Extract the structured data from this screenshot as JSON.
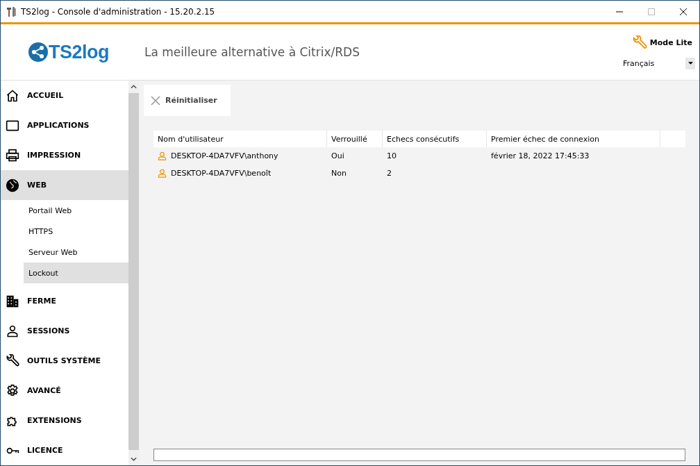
{
  "window": {
    "title": "TS2log - Console d'administration - 15.20.2.15"
  },
  "header": {
    "logo": "TS2log",
    "tagline": "La meilleure alternative à Citrix/RDS",
    "mode_button": "Mode Lite",
    "language": "Français"
  },
  "sidebar": {
    "items": [
      {
        "label": "ACCUEIL",
        "selected": false
      },
      {
        "label": "APPLICATIONS",
        "selected": false
      },
      {
        "label": "IMPRESSION",
        "selected": false
      },
      {
        "label": "WEB",
        "selected": true,
        "children": [
          {
            "label": "Portail Web",
            "selected": false
          },
          {
            "label": "HTTPS",
            "selected": false
          },
          {
            "label": "Serveur Web",
            "selected": false
          },
          {
            "label": "Lockout",
            "selected": true
          }
        ]
      },
      {
        "label": "FERME",
        "selected": false
      },
      {
        "label": "SESSIONS",
        "selected": false
      },
      {
        "label": "OUTILS SYSTÈME",
        "selected": false
      },
      {
        "label": "AVANCÉ",
        "selected": false
      },
      {
        "label": "EXTENSIONS",
        "selected": false
      },
      {
        "label": "LICENCE",
        "selected": false
      }
    ]
  },
  "toolbar": {
    "reset_button": "Réinitialiser"
  },
  "table": {
    "columns": [
      "Nom d'utilisateur",
      "Verrouillé",
      "Echecs consécutifs",
      "Premier échec de connexion"
    ],
    "rows": [
      [
        "DESKTOP-4DA7VFV\\anthony",
        "Oui",
        "10",
        "février 18, 2022 17:45:33"
      ],
      [
        "DESKTOP-4DA7VFV\\benoît",
        "Non",
        "2",
        ""
      ]
    ]
  }
}
